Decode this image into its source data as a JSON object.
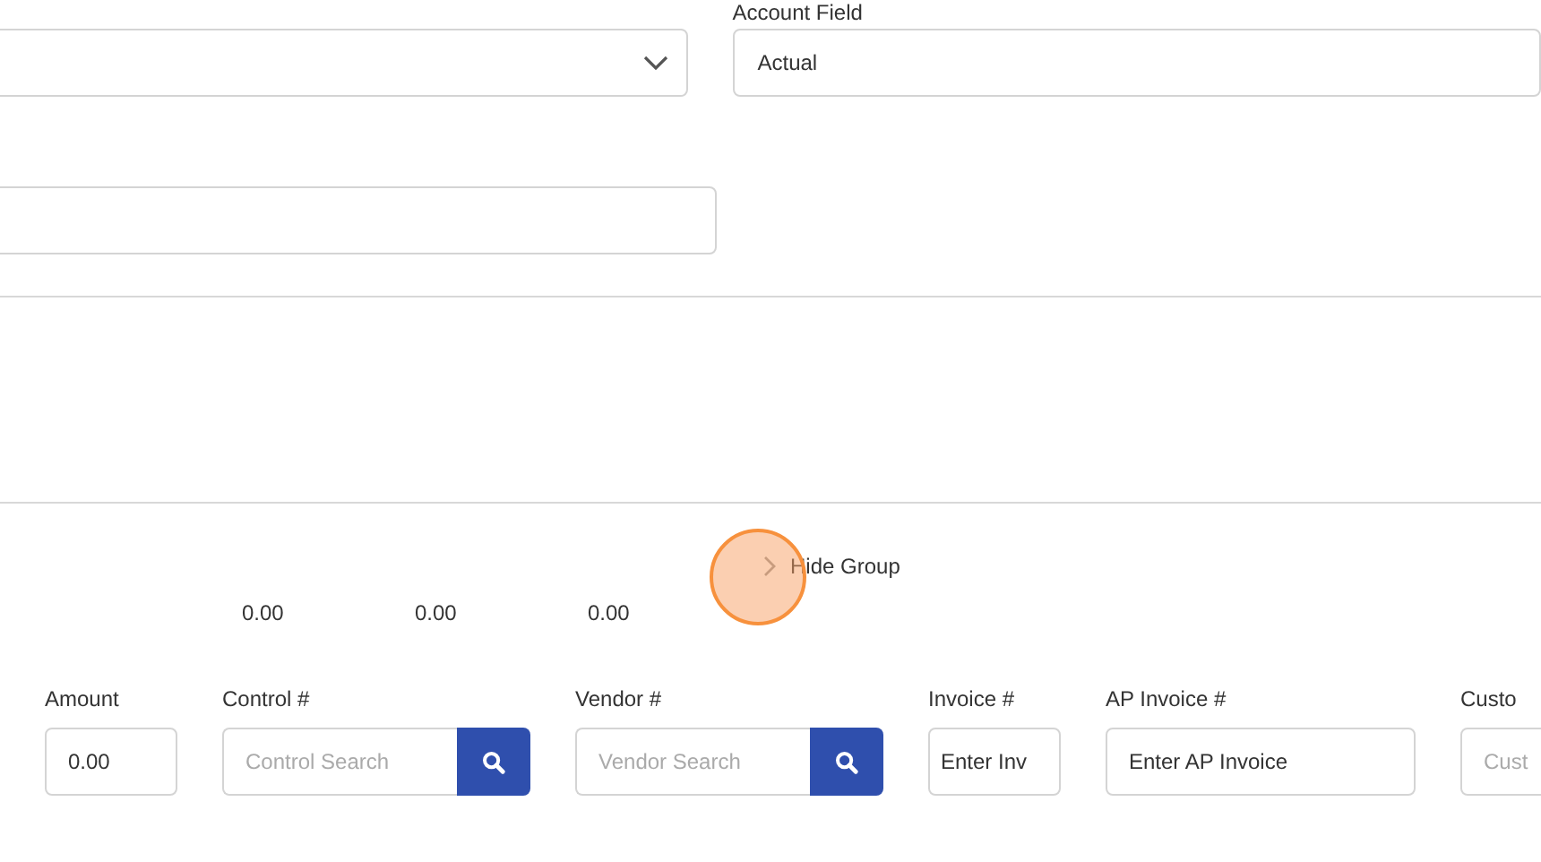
{
  "account_field": {
    "label": "Account Field",
    "value": "Actual"
  },
  "group_toggle": {
    "label": "Hide Group"
  },
  "totals": [
    "0.00",
    "0.00",
    "0.00"
  ],
  "entry_fields": [
    {
      "kind": "text",
      "label": "Amount",
      "value": "0.00"
    },
    {
      "kind": "search",
      "label": "Control #",
      "placeholder": "Control Search"
    },
    {
      "kind": "search",
      "label": "Vendor #",
      "placeholder": "Vendor Search"
    },
    {
      "kind": "text",
      "label": "Invoice #",
      "value": "Enter Inv"
    },
    {
      "kind": "text",
      "label": "AP Invoice #",
      "value": "Enter AP Invoice"
    },
    {
      "kind": "text",
      "label": "Custo",
      "placeholder": "Cust"
    }
  ]
}
